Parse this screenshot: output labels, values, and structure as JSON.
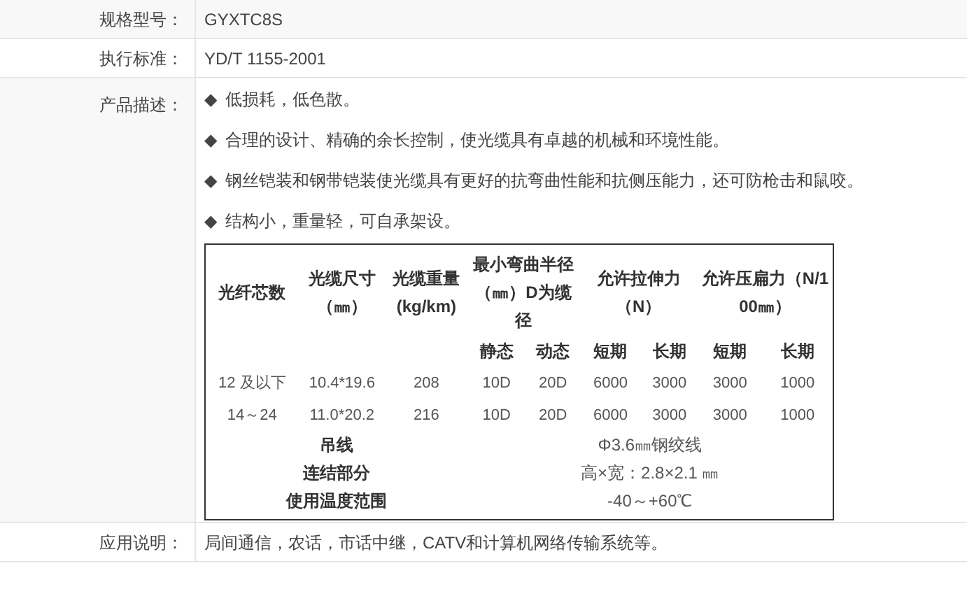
{
  "specs": [
    {
      "label": "规格型号：",
      "kind": "text",
      "value": "GYXTC8S"
    },
    {
      "label": "执行标准：",
      "kind": "text",
      "value": "YD/T 1155-2001"
    },
    {
      "label": "产品描述：",
      "kind": "description",
      "marker": "◆",
      "bullets": [
        "低损耗，低色散。",
        "合理的设计、精确的余长控制，使光缆具有卓越的机械和环境性能。",
        "钢丝铠装和钢带铠装使光缆具有更好的抗弯曲性能和抗侧压能力，还可防枪击和鼠咬。",
        "结构小，重量轻，可自承架设。"
      ],
      "table": {
        "single_headers": [
          "光纤芯数",
          "光缆尺寸（㎜）",
          "光缆重量(kg/km)"
        ],
        "grouped_headers": [
          {
            "text": "最小弯曲半径（㎜）D为缆径",
            "subs": [
              "静态",
              "动态"
            ]
          },
          {
            "text": "允许拉伸力（N）",
            "subs": [
              "短期",
              "长期"
            ]
          },
          {
            "text": "允许压扁力（N/100㎜）",
            "subs": [
              "短期",
              "长期"
            ]
          }
        ],
        "rows": [
          [
            "12 及以下",
            "10.4*19.6",
            "208",
            "10D",
            "20D",
            "6000",
            "3000",
            "3000",
            "1000"
          ],
          [
            "14～24",
            "11.0*20.2",
            "216",
            "10D",
            "20D",
            "6000",
            "3000",
            "3000",
            "1000"
          ]
        ],
        "extras": [
          {
            "label": "吊线",
            "value": "Φ3.6㎜钢绞线"
          },
          {
            "label": "连结部分",
            "value": "高×宽：2.8×2.1 ㎜"
          },
          {
            "label": "使用温度范围",
            "value": "-40～+60℃"
          }
        ]
      }
    },
    {
      "label": "应用说明：",
      "kind": "text",
      "value": "局间通信，农话，市话中继，CATV和计算机网络传输系统等。"
    }
  ]
}
